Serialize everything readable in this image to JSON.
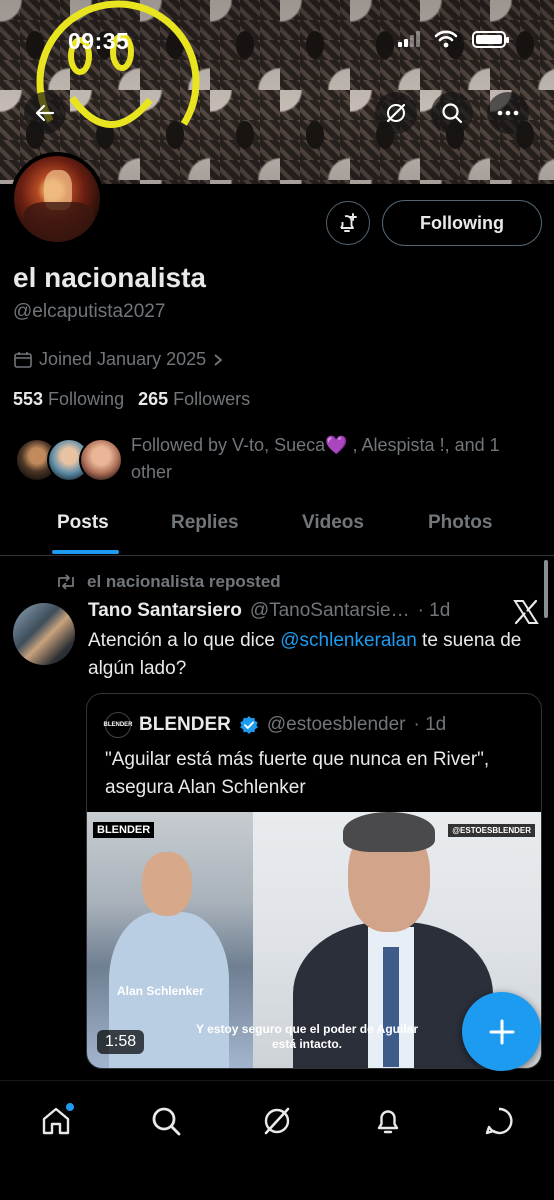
{
  "status_bar": {
    "time": "09:35"
  },
  "profile": {
    "name": "el nacionalista",
    "handle": "@elcaputista2027",
    "joined": "Joined January 2025",
    "following_count": "553",
    "following_label": "Following",
    "followers_count": "265",
    "followers_label": "Followers",
    "follow_button_label": "Following",
    "followed_by_text": "Followed by V-to, Sueca💜 , Alespista !, and 1 other"
  },
  "tabs": [
    {
      "label": "Posts",
      "active": true
    },
    {
      "label": "Replies",
      "active": false
    },
    {
      "label": "Videos",
      "active": false
    },
    {
      "label": "Photos",
      "active": false
    }
  ],
  "post": {
    "repost_label": "el nacionalista reposted",
    "author_name": "Tano Santarsiero",
    "author_handle": "@TanoSantarsie…",
    "time": "· 1d",
    "text_before": "Atención a lo que dice ",
    "mention": "@schlenkeralan",
    "text_after": " te suena de algún lado?",
    "quote": {
      "logo_text": "BLENDER",
      "name": "BLENDER",
      "handle": "@estoesblender",
      "time": "· 1d",
      "text": "\"Aguilar está más fuerte que nunca en River\", asegura Alan Schlenker",
      "media": {
        "tag_left": "BLENDER",
        "tag_right": "@ESTOESBLENDER",
        "name_caption": "Alan Schlenker",
        "subtitle": "Y estoy seguro que el poder de Aguilar está intacto.",
        "duration": "1:58"
      }
    }
  },
  "colors": {
    "accent": "#1d9bf0",
    "text": "#e7e9ea",
    "muted": "#71767b",
    "border": "#2f3336"
  },
  "icons": {
    "back": "back-arrow-icon",
    "grok": "grok-icon",
    "search": "search-icon",
    "more": "more-icon",
    "notify": "bell-plus-icon",
    "calendar": "calendar-icon",
    "repost": "repost-icon",
    "x_logo": "x-logo-icon",
    "verified": "verified-badge-icon",
    "compose": "plus-icon"
  },
  "bottom_nav": [
    "home-icon",
    "search-icon",
    "grok-icon",
    "notifications-icon",
    "messages-icon"
  ]
}
